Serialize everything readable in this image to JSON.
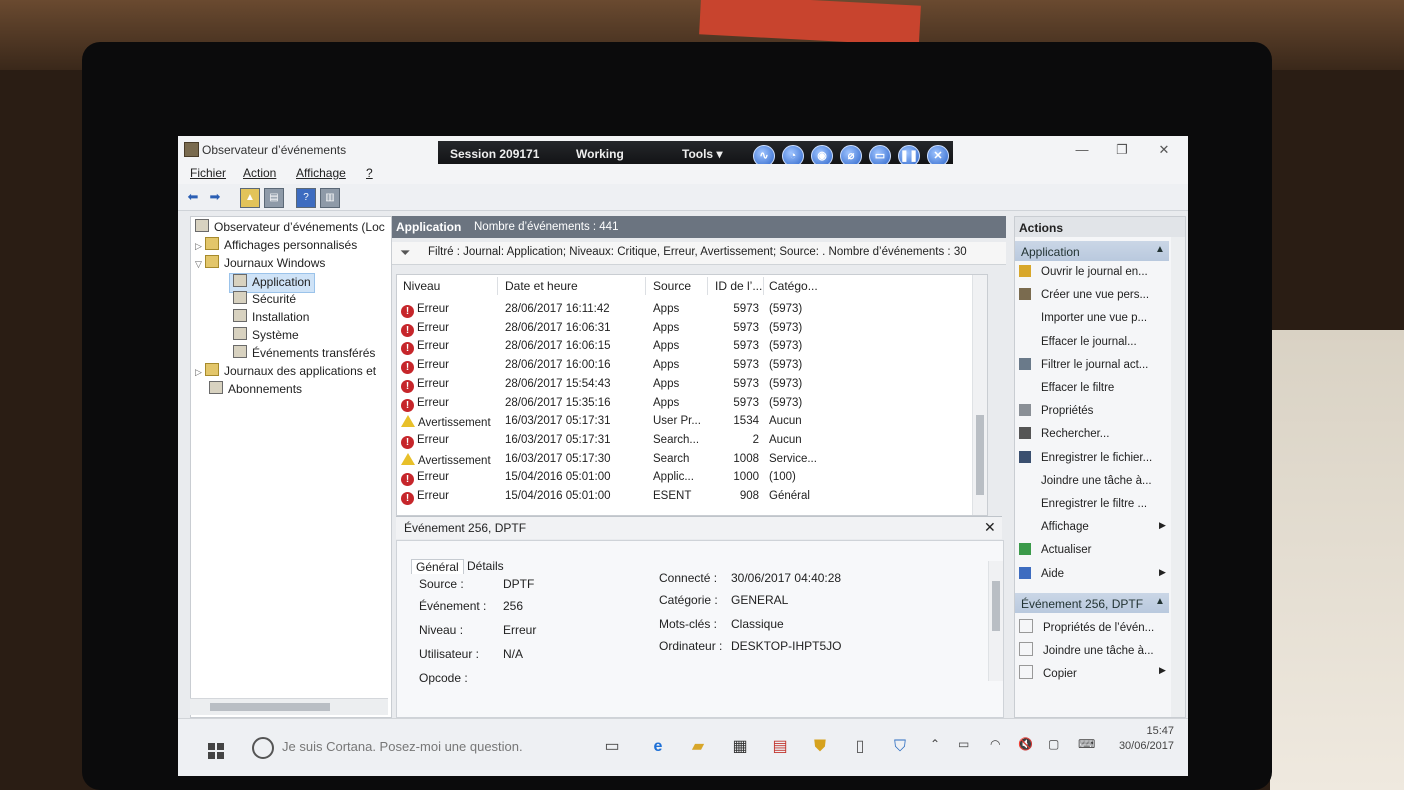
{
  "window": {
    "title": "Observateur d’événements",
    "controls": {
      "minimize": "—",
      "restore": "❐",
      "close": "✕"
    }
  },
  "session_toolbar": {
    "session": "Session 209171",
    "status": "Working",
    "tools": "Tools ▾"
  },
  "menu": [
    "Fichier",
    "Action",
    "Affichage",
    "?"
  ],
  "tree": {
    "root": "Observateur d’événements (Loc",
    "custom_views": "Affichages personnalisés",
    "windows_logs": "Journaux Windows",
    "logs": [
      "Application",
      "Sécurité",
      "Installation",
      "Système",
      "Événements transférés"
    ],
    "apps_logs": "Journaux des applications et",
    "subscriptions": "Abonnements"
  },
  "center": {
    "title": "Application",
    "count": "Nombre d’événements : 441",
    "filter": "Filtré : Journal: Application; Niveaux: Critique, Erreur, Avertissement; Source: . Nombre d’événements : 30",
    "columns": [
      "Niveau",
      "Date et heure",
      "Source",
      "ID de l’...",
      "Catégo..."
    ],
    "rows": [
      {
        "level": "Erreur",
        "type": "error",
        "date": "28/06/2017 16:11:42",
        "source": "Apps",
        "id": "5973",
        "cat": "(5973)"
      },
      {
        "level": "Erreur",
        "type": "error",
        "date": "28/06/2017 16:06:31",
        "source": "Apps",
        "id": "5973",
        "cat": "(5973)"
      },
      {
        "level": "Erreur",
        "type": "error",
        "date": "28/06/2017 16:06:15",
        "source": "Apps",
        "id": "5973",
        "cat": "(5973)"
      },
      {
        "level": "Erreur",
        "type": "error",
        "date": "28/06/2017 16:00:16",
        "source": "Apps",
        "id": "5973",
        "cat": "(5973)"
      },
      {
        "level": "Erreur",
        "type": "error",
        "date": "28/06/2017 15:54:43",
        "source": "Apps",
        "id": "5973",
        "cat": "(5973)"
      },
      {
        "level": "Erreur",
        "type": "error",
        "date": "28/06/2017 15:35:16",
        "source": "Apps",
        "id": "5973",
        "cat": "(5973)"
      },
      {
        "level": "Avertissement",
        "type": "warning",
        "date": "16/03/2017 05:17:31",
        "source": "User Pr...",
        "id": "1534",
        "cat": "Aucun"
      },
      {
        "level": "Erreur",
        "type": "error",
        "date": "16/03/2017 05:17:31",
        "source": "Search...",
        "id": "2",
        "cat": "Aucun"
      },
      {
        "level": "Avertissement",
        "type": "warning",
        "date": "16/03/2017 05:17:30",
        "source": "Search",
        "id": "1008",
        "cat": "Service..."
      },
      {
        "level": "Erreur",
        "type": "error",
        "date": "15/04/2016 05:01:00",
        "source": "Applic...",
        "id": "1000",
        "cat": "(100)"
      },
      {
        "level": "Erreur",
        "type": "error",
        "date": "15/04/2016 05:01:00",
        "source": "ESENT",
        "id": "908",
        "cat": "Général"
      }
    ]
  },
  "detail": {
    "title": "Événement 256, DPTF",
    "tabs": [
      "Général",
      "Détails"
    ],
    "fields": {
      "source_label": "Source :",
      "source_value": "DPTF",
      "event_label": "Événement :",
      "event_value": "256",
      "level_label": "Niveau :",
      "level_value": "Erreur",
      "user_label": "Utilisateur :",
      "user_value": "N/A",
      "opcode_label": "Opcode :",
      "logged_label": "Connecté :",
      "logged_value": "30/06/2017 04:40:28",
      "category_label": "Catégorie :",
      "category_value": "GENERAL",
      "keywords_label": "Mots-clés :",
      "keywords_value": "Classique",
      "computer_label": "Ordinateur :",
      "computer_value": "DESKTOP-IHPT5JO"
    }
  },
  "actions": {
    "title": "Actions",
    "section1": "Application",
    "items1": [
      "Ouvrir le journal en...",
      "Créer une vue pers...",
      "Importer une vue p...",
      "Effacer le journal...",
      "Filtrer le journal act...",
      "Effacer le filtre",
      "Propriétés",
      "Rechercher...",
      "Enregistrer le fichier...",
      "Joindre une tâche à...",
      "Enregistrer le filtre ...",
      "Affichage",
      "Actualiser",
      "Aide"
    ],
    "section2": "Événement 256, DPTF",
    "items2": [
      "Propriétés de l’évén...",
      "Joindre une tâche à...",
      "Copier"
    ]
  },
  "taskbar": {
    "search": "Je suis Cortana. Posez-moi une question.",
    "time": "15:47",
    "date": "30/06/2017"
  }
}
